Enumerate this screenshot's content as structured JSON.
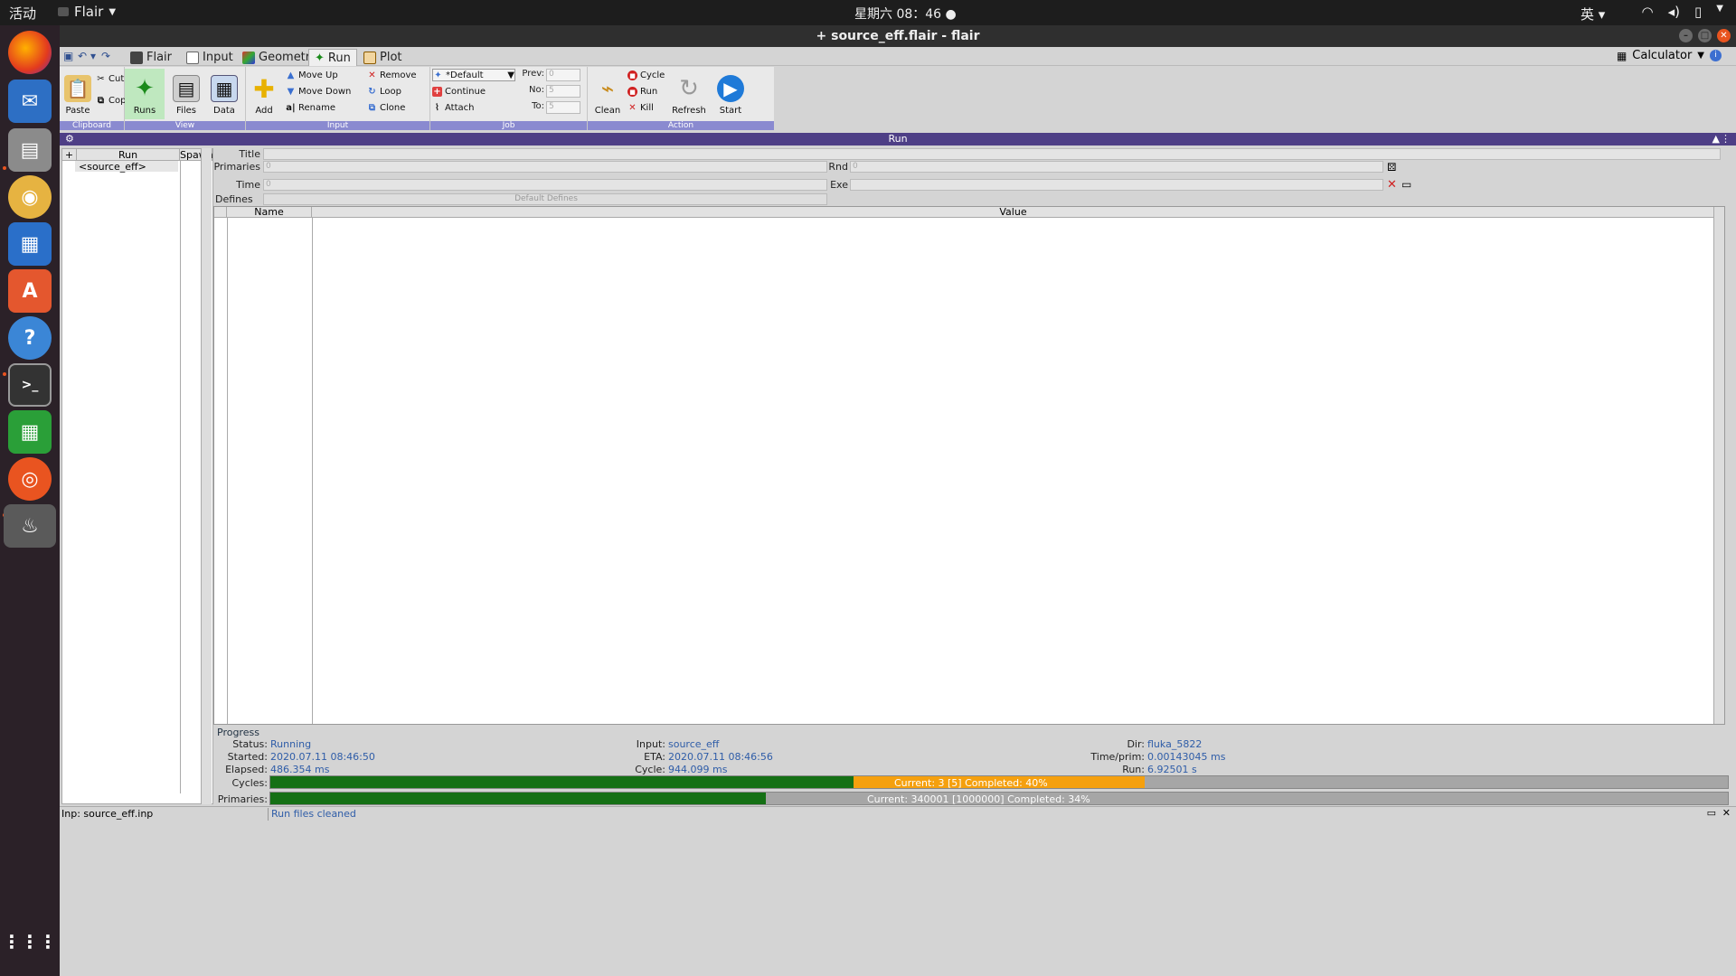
{
  "topbar": {
    "activities": "活动",
    "app_menu": "Flair",
    "clock": "星期六 08：46",
    "ime": "英"
  },
  "window": {
    "title": "+ source_eff.flair - flair"
  },
  "tabs": [
    {
      "label": "Flair"
    },
    {
      "label": "Input"
    },
    {
      "label": "Geometry"
    },
    {
      "label": "Run"
    },
    {
      "label": "Plot"
    }
  ],
  "calculator": "Calculator",
  "ribbon": {
    "clipboard": {
      "paste": "Paste",
      "cut": "Cut",
      "copy": "Copy",
      "label": "Clipboard"
    },
    "view": {
      "runs": "Runs",
      "files": "Files",
      "data": "Data",
      "label": "View"
    },
    "input": {
      "add": "Add",
      "move_up": "Move Up",
      "move_down": "Move Down",
      "rename": "Rename",
      "remove": "Remove",
      "loop": "Loop",
      "clone": "Clone",
      "label": "Input"
    },
    "job": {
      "queue": "*Default",
      "continue": "Continue",
      "attach": "Attach",
      "prev": "Prev:",
      "no": "No:",
      "to": "To:",
      "prev_value": "0",
      "no_value": "5",
      "to_value": "5",
      "label": "Job"
    },
    "action": {
      "clean": "Clean",
      "cycle": "Cycle",
      "run": "Run",
      "kill": "Kill",
      "refresh": "Refresh",
      "start": "Start",
      "label": "Action"
    }
  },
  "run_header": "Run",
  "run_list": {
    "col_run": "Run",
    "col_spawn": "Spawn",
    "items": [
      "<source_eff>"
    ]
  },
  "form": {
    "title_label": "Title",
    "primaries_label": "Primaries",
    "primaries_value": "0",
    "rnd_label": "Rnd",
    "rnd_value": "0",
    "time_label": "Time",
    "time_value": "0",
    "exe_label": "Exe",
    "defines_label": "Defines",
    "default_defines": "Default Defines"
  },
  "grid": {
    "col_name": "Name",
    "col_value": "Value"
  },
  "progress": {
    "title": "Progress",
    "status_label": "Status:",
    "status": "Running",
    "started_label": "Started:",
    "started": "2020.07.11 08:46:50",
    "elapsed_label": "Elapsed:",
    "elapsed": "486.354 ms",
    "input_label": "Input:",
    "input": "source_eff",
    "eta_label": "ETA:",
    "eta": "2020.07.11 08:46:56",
    "cycle_label": "Cycle:",
    "cycle": "944.099 ms",
    "dir_label": "Dir:",
    "dir": "fluka_5822",
    "timeprim_label": "Time/prim:",
    "timeprim": "0.00143045 ms",
    "run_label": "Run:",
    "run": "6.92501 s",
    "cycles_label": "Cycles:",
    "cycles_text": "Current: 3 [5]  Completed: 40%",
    "cycles_completed": 0.4,
    "cycles_current": 0.6,
    "primaries_label": "Primaries:",
    "primaries_text": "Current: 340001 [1000000]  Completed: 34%",
    "primaries_completed": 0.34
  },
  "statusbar": {
    "input": "Inp: source_eff.inp",
    "message": "Run files cleaned"
  }
}
